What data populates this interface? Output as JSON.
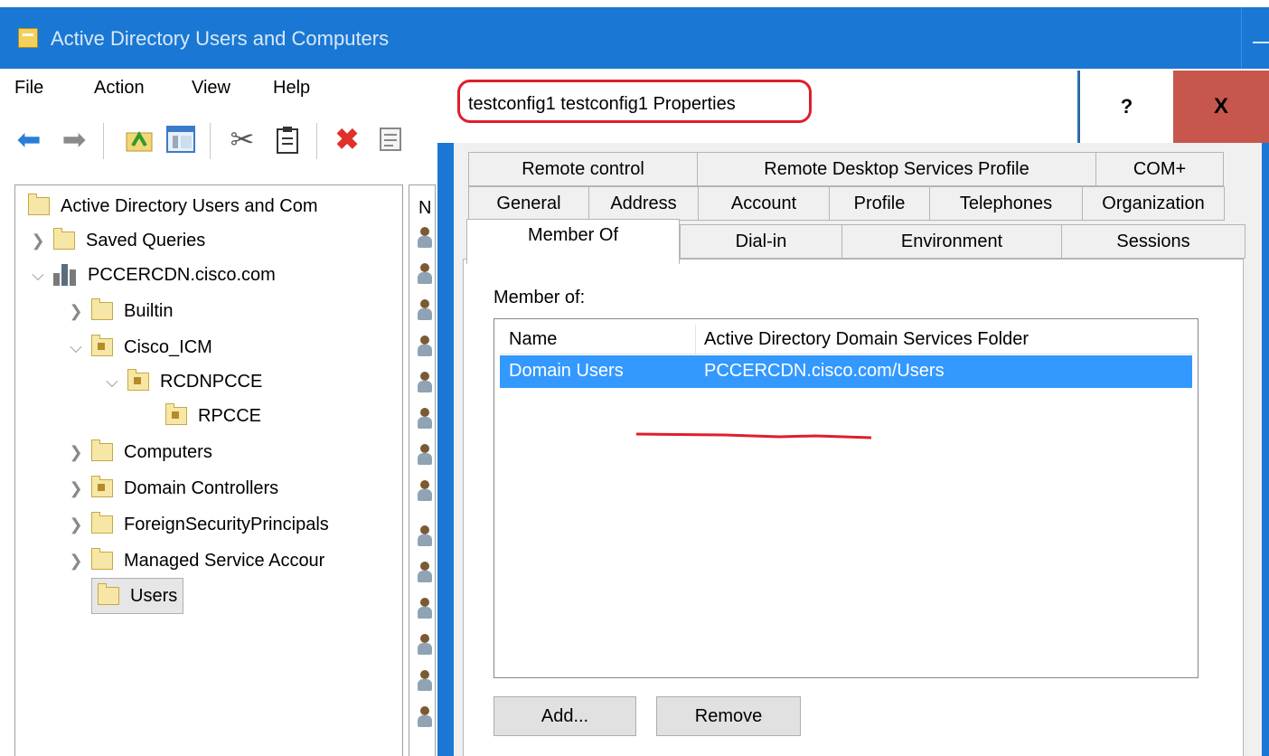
{
  "main_window": {
    "title": "Active Directory Users and Computers"
  },
  "menu": {
    "file": "File",
    "action": "Action",
    "view": "View",
    "help": "Help"
  },
  "tree": {
    "root": "Active Directory Users and Com",
    "saved_queries": "Saved Queries",
    "domain": "PCCERCDN.cisco.com",
    "builtin": "Builtin",
    "cisco_icm": "Cisco_ICM",
    "rcdnpcce": "RCDNPCCE",
    "rpcce": "RPCCE",
    "computers": "Computers",
    "domain_controllers": "Domain Controllers",
    "foreign_security": "ForeignSecurityPrincipals",
    "managed_service": "Managed Service Accour",
    "users": "Users"
  },
  "list_pane": {
    "header": "N"
  },
  "dialog": {
    "title": "testconfig1 testconfig1 Properties",
    "help": "?",
    "close": "X",
    "tabs_row1": [
      "Remote control",
      "Remote Desktop Services Profile",
      "COM+"
    ],
    "tabs_row2": [
      "General",
      "Address",
      "Account",
      "Profile",
      "Telephones",
      "Organization"
    ],
    "tabs_row3": [
      "Member Of",
      "Dial-in",
      "Environment",
      "Sessions"
    ],
    "member_of_label": "Member of:",
    "columns": [
      "Name",
      "Active Directory Domain Services Folder"
    ],
    "rows": [
      {
        "name": "Domain Users",
        "folder": "PCCERCDN.cisco.com/Users"
      }
    ],
    "add_button": "Add...",
    "remove_button": "Remove"
  },
  "colors": {
    "titlebar": "#1a78d4",
    "selection": "#3399ff",
    "close": "#c7574c",
    "annotation": "#e01e2a"
  }
}
